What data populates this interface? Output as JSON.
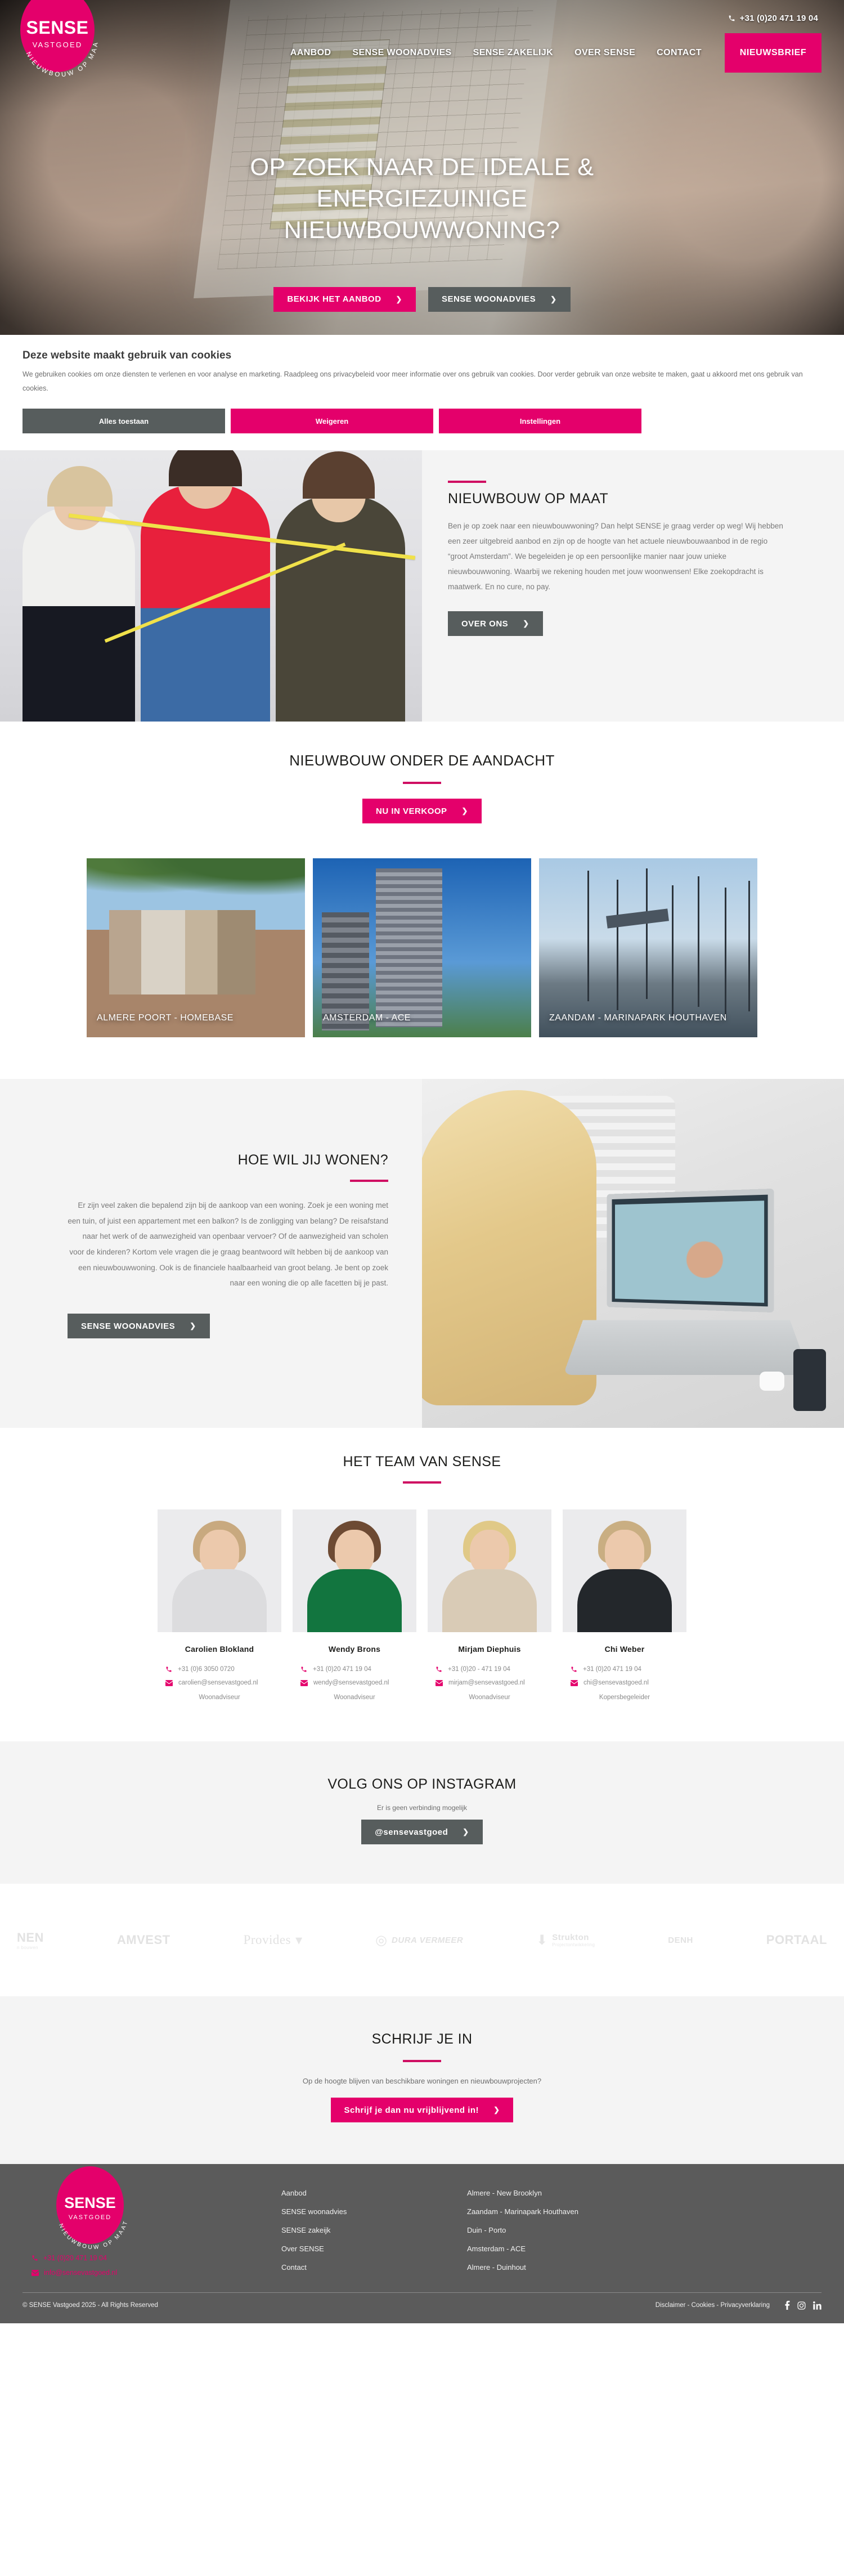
{
  "header": {
    "phone": "+31 (0)20 471 19 04",
    "phone_icon": "phone-icon",
    "logo": {
      "line1": "SENSE",
      "line2": "VASTGOED",
      "arc": "NIEUWBOUW OP MAAT"
    },
    "nav": [
      {
        "label": "AANBOD"
      },
      {
        "label": "SENSE WOONADVIES"
      },
      {
        "label": "SENSE ZAKELIJK"
      },
      {
        "label": "OVER SENSE"
      },
      {
        "label": "CONTACT"
      }
    ],
    "cta": "NIEUWSBRIEF"
  },
  "hero": {
    "title_line1": "OP ZOEK NAAR DE IDEALE &",
    "title_line2": "ENERGIEZUINIGE",
    "title_line3": "NIEUWBOUWWONING?",
    "btn_primary": "BEKIJK HET AANBOD",
    "btn_secondary": "SENSE WOONADVIES"
  },
  "cookie": {
    "title": "Deze website maakt gebruik van cookies",
    "body": "We gebruiken cookies om onze diensten te verlenen en voor analyse en marketing. Raadpleeg ons privacybeleid voor meer informatie over ons gebruik van cookies. Door verder gebruik van onze website te maken, gaat u akkoord met ons gebruik van cookies.",
    "accept": "Alles toestaan",
    "reject": "Weigeren",
    "settings": "Instellingen"
  },
  "about": {
    "title": "NIEUWBOUW OP MAAT",
    "body": "Ben je op zoek naar een nieuwbouwwoning? Dan helpt SENSE je graag verder op weg! Wij hebben een zeer uitgebreid aanbod en zijn op de hoogte van het actuele nieuwbouwaanbod in de regio “groot Amsterdam”. We begeleiden je op een persoonlijke manier naar jouw unieke nieuwbouwwoning. Waarbij we rekening houden met jouw woonwensen! Elke zoekopdracht is maatwerk. En no cure, no pay.",
    "button": "OVER ONS"
  },
  "projects": {
    "title": "NIEUWBOUW ONDER DE AANDACHT",
    "button": "NU IN VERKOOP",
    "cards": [
      {
        "title": "ALMERE POORT - HOMEBASE"
      },
      {
        "title": "AMSTERDAM - ACE"
      },
      {
        "title": "ZAANDAM - MARINAPARK HOUTHAVEN"
      }
    ]
  },
  "wonen": {
    "title": "HOE WIL JIJ WONEN?",
    "body": "Er zijn veel zaken die bepalend zijn bij de aankoop van een woning. Zoek je een woning met een tuin, of juist een appartement met een balkon? Is de zonligging van belang? De reisafstand naar het werk of de aanwezigheid van openbaar vervoer? Of de aanwezigheid van scholen voor de kinderen? Kortom vele vragen die je graag beantwoord wilt hebben bij de aankoop van een nieuwbouwwoning. Ook is de financiele haalbaarheid van groot belang. Je bent op zoek naar een woning die op alle facetten bij je past.",
    "button": "SENSE WOONADVIES"
  },
  "team": {
    "title": "HET TEAM VAN SENSE",
    "members": [
      {
        "name": "Carolien Blokland",
        "phone": "+31 (0)6 3050 0720",
        "email": "carolien@sensevastgoed.nl",
        "role": "Woonadviseur"
      },
      {
        "name": "Wendy Brons",
        "phone": "+31 (0)20 471 19 04",
        "email": "wendy@sensevastgoed.nl",
        "role": "Woonadviseur"
      },
      {
        "name": "Mirjam Diephuis",
        "phone": "+31 (0)20 - 471 19 04",
        "email": "mirjam@sensevastgoed.nl",
        "role": "Woonadviseur"
      },
      {
        "name": "Chi Weber",
        "phone": "+31 (0)20 471 19 04",
        "email": "chi@sensevastgoed.nl",
        "role": "Kopersbegeleider"
      }
    ]
  },
  "instagram": {
    "title": "VOLG ONS OP INSTAGRAM",
    "status": "Er is geen verbinding mogelijk",
    "button": "@sensevastgoed"
  },
  "partners": [
    {
      "name": "NEN",
      "sub": "n bouwen",
      "style": "bold"
    },
    {
      "name": "AMVEST",
      "sub": "",
      "style": "bold"
    },
    {
      "name": "Provides",
      "sub": "",
      "style": "serif"
    },
    {
      "name": "DURA VERMEER",
      "sub": "",
      "style": "italic"
    },
    {
      "name": "Strukton",
      "sub": "Projectontwikkeling",
      "style": "small"
    },
    {
      "name": "DENH",
      "sub": "",
      "style": "mark"
    },
    {
      "name": "PORTAAL",
      "sub": "",
      "style": "bold"
    }
  ],
  "signup": {
    "title": "SCHRIJF JE IN",
    "sub": "Op de hoogte blijven van beschikbare woningen en nieuwbouwprojecten?",
    "button": "Schrijf je dan nu vrijblijvend in!"
  },
  "footer": {
    "logo": {
      "line1": "SENSE",
      "line2": "VASTGOED",
      "arc": "NIEUWBOUW OP MAAT"
    },
    "phone": "+31 (0)20 471 19 04",
    "email": "info@sensevastgoed.nl",
    "col_links": [
      {
        "label": "Aanbod"
      },
      {
        "label": "SENSE woonadvies"
      },
      {
        "label": "SENSE zakeijk"
      },
      {
        "label": "Over SENSE"
      },
      {
        "label": "Contact"
      }
    ],
    "col_projects": [
      {
        "label": "Almere - New Brooklyn"
      },
      {
        "label": "Zaandam - Marinapark Houthaven"
      },
      {
        "label": "Duin - Porto"
      },
      {
        "label": "Amsterdam - ACE"
      },
      {
        "label": "Almere - Duinhout"
      }
    ],
    "copyright": "© SENSE Vastgoed 2025 - All Rights Reserved",
    "legal": "Disclaimer - Cookies - Privacyverklaring",
    "social": [
      "facebook-icon",
      "instagram-icon",
      "linkedin-icon"
    ]
  },
  "colors": {
    "brand_pink": "#e4006b",
    "accent_rule": "#cf0e62",
    "grey_button": "#575d5d",
    "footer_bg": "#5b5b5b",
    "section_grey": "#f4f4f4"
  }
}
